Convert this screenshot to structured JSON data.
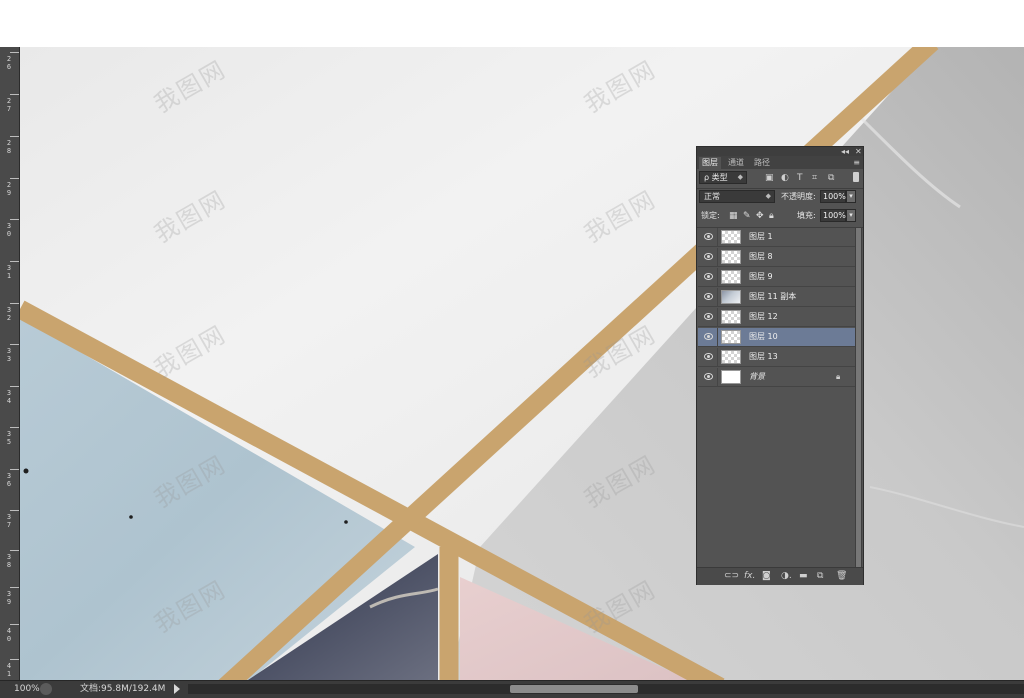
{
  "ruler": {
    "labels": [
      "26",
      "27",
      "28",
      "29",
      "30",
      "31",
      "32",
      "33",
      "34",
      "35",
      "36",
      "37",
      "38",
      "39",
      "40",
      "41"
    ]
  },
  "watermark": {
    "text": "我图网"
  },
  "status": {
    "zoom": "100%",
    "doc_size": "文档:95.8M/192.4M"
  },
  "panel": {
    "close_label": "✕",
    "collapse_label": "◂◂",
    "tabs": [
      {
        "label": "图层",
        "active": true
      },
      {
        "label": "通道",
        "active": false
      },
      {
        "label": "路径",
        "active": false
      }
    ],
    "menu_icon": "≡",
    "filter_label": "ρ 类型",
    "blend_mode": "正常",
    "opacity_label": "不透明度:",
    "opacity_value": "100%",
    "lock_label": "锁定:",
    "fill_label": "填充:",
    "fill_value": "100%",
    "layers": [
      {
        "name": "图层 1",
        "thumb": "transparent",
        "selected": false
      },
      {
        "name": "图层 8",
        "thumb": "transparent",
        "selected": false
      },
      {
        "name": "图层 9",
        "thumb": "transparent",
        "selected": false
      },
      {
        "name": "图层 11 副本",
        "thumb": "image",
        "selected": false
      },
      {
        "name": "图层 12",
        "thumb": "transparent",
        "selected": false
      },
      {
        "name": "图层 10",
        "thumb": "transparent",
        "selected": true
      },
      {
        "name": "图层 13",
        "thumb": "transparent",
        "selected": false
      },
      {
        "name": "背景",
        "thumb": "white",
        "selected": false,
        "locked": true
      }
    ],
    "bottom_icons": [
      "link-icon",
      "fx-icon",
      "mask-icon",
      "adjustment-icon",
      "folder-icon",
      "new-layer-icon",
      "trash-icon"
    ]
  },
  "colors": {
    "panel_bg": "#535353",
    "selected_layer": "#6c7b96",
    "gold": "#c9a46e",
    "marble_blue": "#aec3cf",
    "marble_pink": "#e3cbcb"
  }
}
